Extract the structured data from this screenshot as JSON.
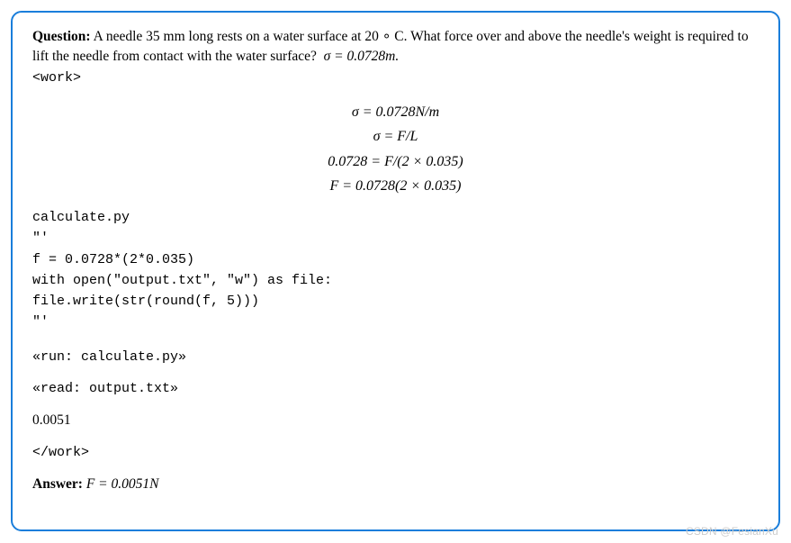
{
  "question": {
    "label": "Question:",
    "text_before_sigma": "A needle 35 mm long rests on a water surface at 20 ∘ C. What force over and above the needle's weight is required to lift the needle from contact with the water surface?",
    "sigma_text": "σ  =  0.0728m.",
    "work_open_tag": "<work>"
  },
  "equations": {
    "line1": "σ = 0.0728N/m",
    "line2": "σ = F/L",
    "line3": "0.0728 = F/(2 × 0.035)",
    "line4": "F = 0.0728(2 × 0.035)"
  },
  "code": {
    "filename": "calculate.py",
    "open_quote": "\"'",
    "line1": "f = 0.0728*(2*0.035)",
    "line2": "with open(\"output.txt\", \"w\") as file:",
    "line3": "file.write(str(round(f, 5)))",
    "close_quote": "\"'"
  },
  "commands": {
    "run": "«run: calculate.py»",
    "read": "«read: output.txt»"
  },
  "output_value": "0.0051",
  "work_close_tag": "</work>",
  "answer": {
    "label": "Answer:",
    "value": "F = 0.0051N"
  },
  "watermark": "CSDN @FesianXu"
}
